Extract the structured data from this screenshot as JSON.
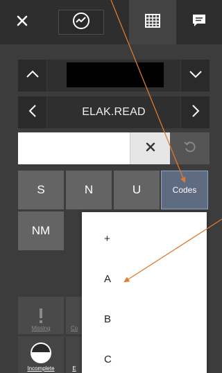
{
  "toolbar": {
    "tabs": [
      {
        "icon": "close-icon"
      },
      {
        "icon": "activity-icon"
      },
      {
        "icon": "grid-icon"
      },
      {
        "icon": "chat-icon"
      }
    ]
  },
  "field_nav": {
    "form_name": "ELAK.READ"
  },
  "entry": {
    "value": "",
    "clear_symbol": "✕"
  },
  "code_buttons": [
    "S",
    "N",
    "U",
    "Codes",
    "NM"
  ],
  "status_buttons": {
    "missing_label": "Missing",
    "missing_label_2": "Co",
    "incomplete_label": "Incomplete",
    "incomplete_label_2": "E"
  },
  "codes_menu": {
    "items": [
      "+",
      "A",
      "B",
      "C"
    ]
  },
  "colors": {
    "annotation_arrow": "#e07a2c",
    "selected_button": "#5f6b80"
  }
}
